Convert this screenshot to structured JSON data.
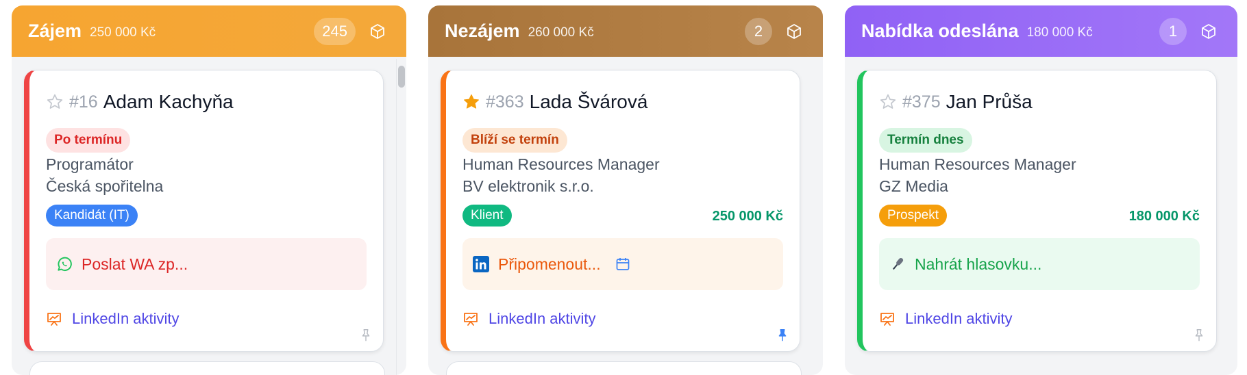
{
  "columns": [
    {
      "title": "Zájem",
      "amount": "250 000 Kč",
      "count": "245",
      "header_color": "#f6a531",
      "card": {
        "number": "#16",
        "name": "Adam Kachyňa",
        "starred": false,
        "status_label": "Po termínu",
        "role": "Programátor",
        "company": "Česká spořitelna",
        "type_label": "Kandidát (IT)",
        "value": "",
        "action_icon": "whatsapp-icon",
        "action_text": "Poslat WA zp...",
        "activity_label": "LinkedIn aktivity",
        "pinned": false
      }
    },
    {
      "title": "Nezájem",
      "amount": "260 000 Kč",
      "count": "2",
      "header_color": "#b07a3e",
      "card": {
        "number": "#363",
        "name": "Lada Švárová",
        "starred": true,
        "status_label": "Blíží se termín",
        "role": "Human Resources Manager",
        "company": "BV elektronik s.r.o.",
        "type_label": "Klient",
        "value": "250 000 Kč",
        "action_icon": "linkedin-icon",
        "action_text": "Připomenout...",
        "activity_label": "LinkedIn aktivity",
        "pinned": true
      }
    },
    {
      "title": "Nabídka odeslána",
      "amount": "180 000 Kč",
      "count": "1",
      "header_color": "#9b6bf6",
      "card": {
        "number": "#375",
        "name": "Jan Průša",
        "starred": false,
        "status_label": "Termín dnes",
        "role": "Human Resources Manager",
        "company": "GZ Media",
        "type_label": "Prospekt",
        "value": "180 000 Kč",
        "action_icon": "microphone-icon",
        "action_text": "Nahrát hlasovku...",
        "activity_label": "LinkedIn aktivity",
        "pinned": false
      }
    }
  ],
  "colors": {
    "red_accent": "#ef4444",
    "orange_accent": "#f97316",
    "green_accent": "#22c55e",
    "link": "#4f46e5",
    "value": "#059669"
  }
}
